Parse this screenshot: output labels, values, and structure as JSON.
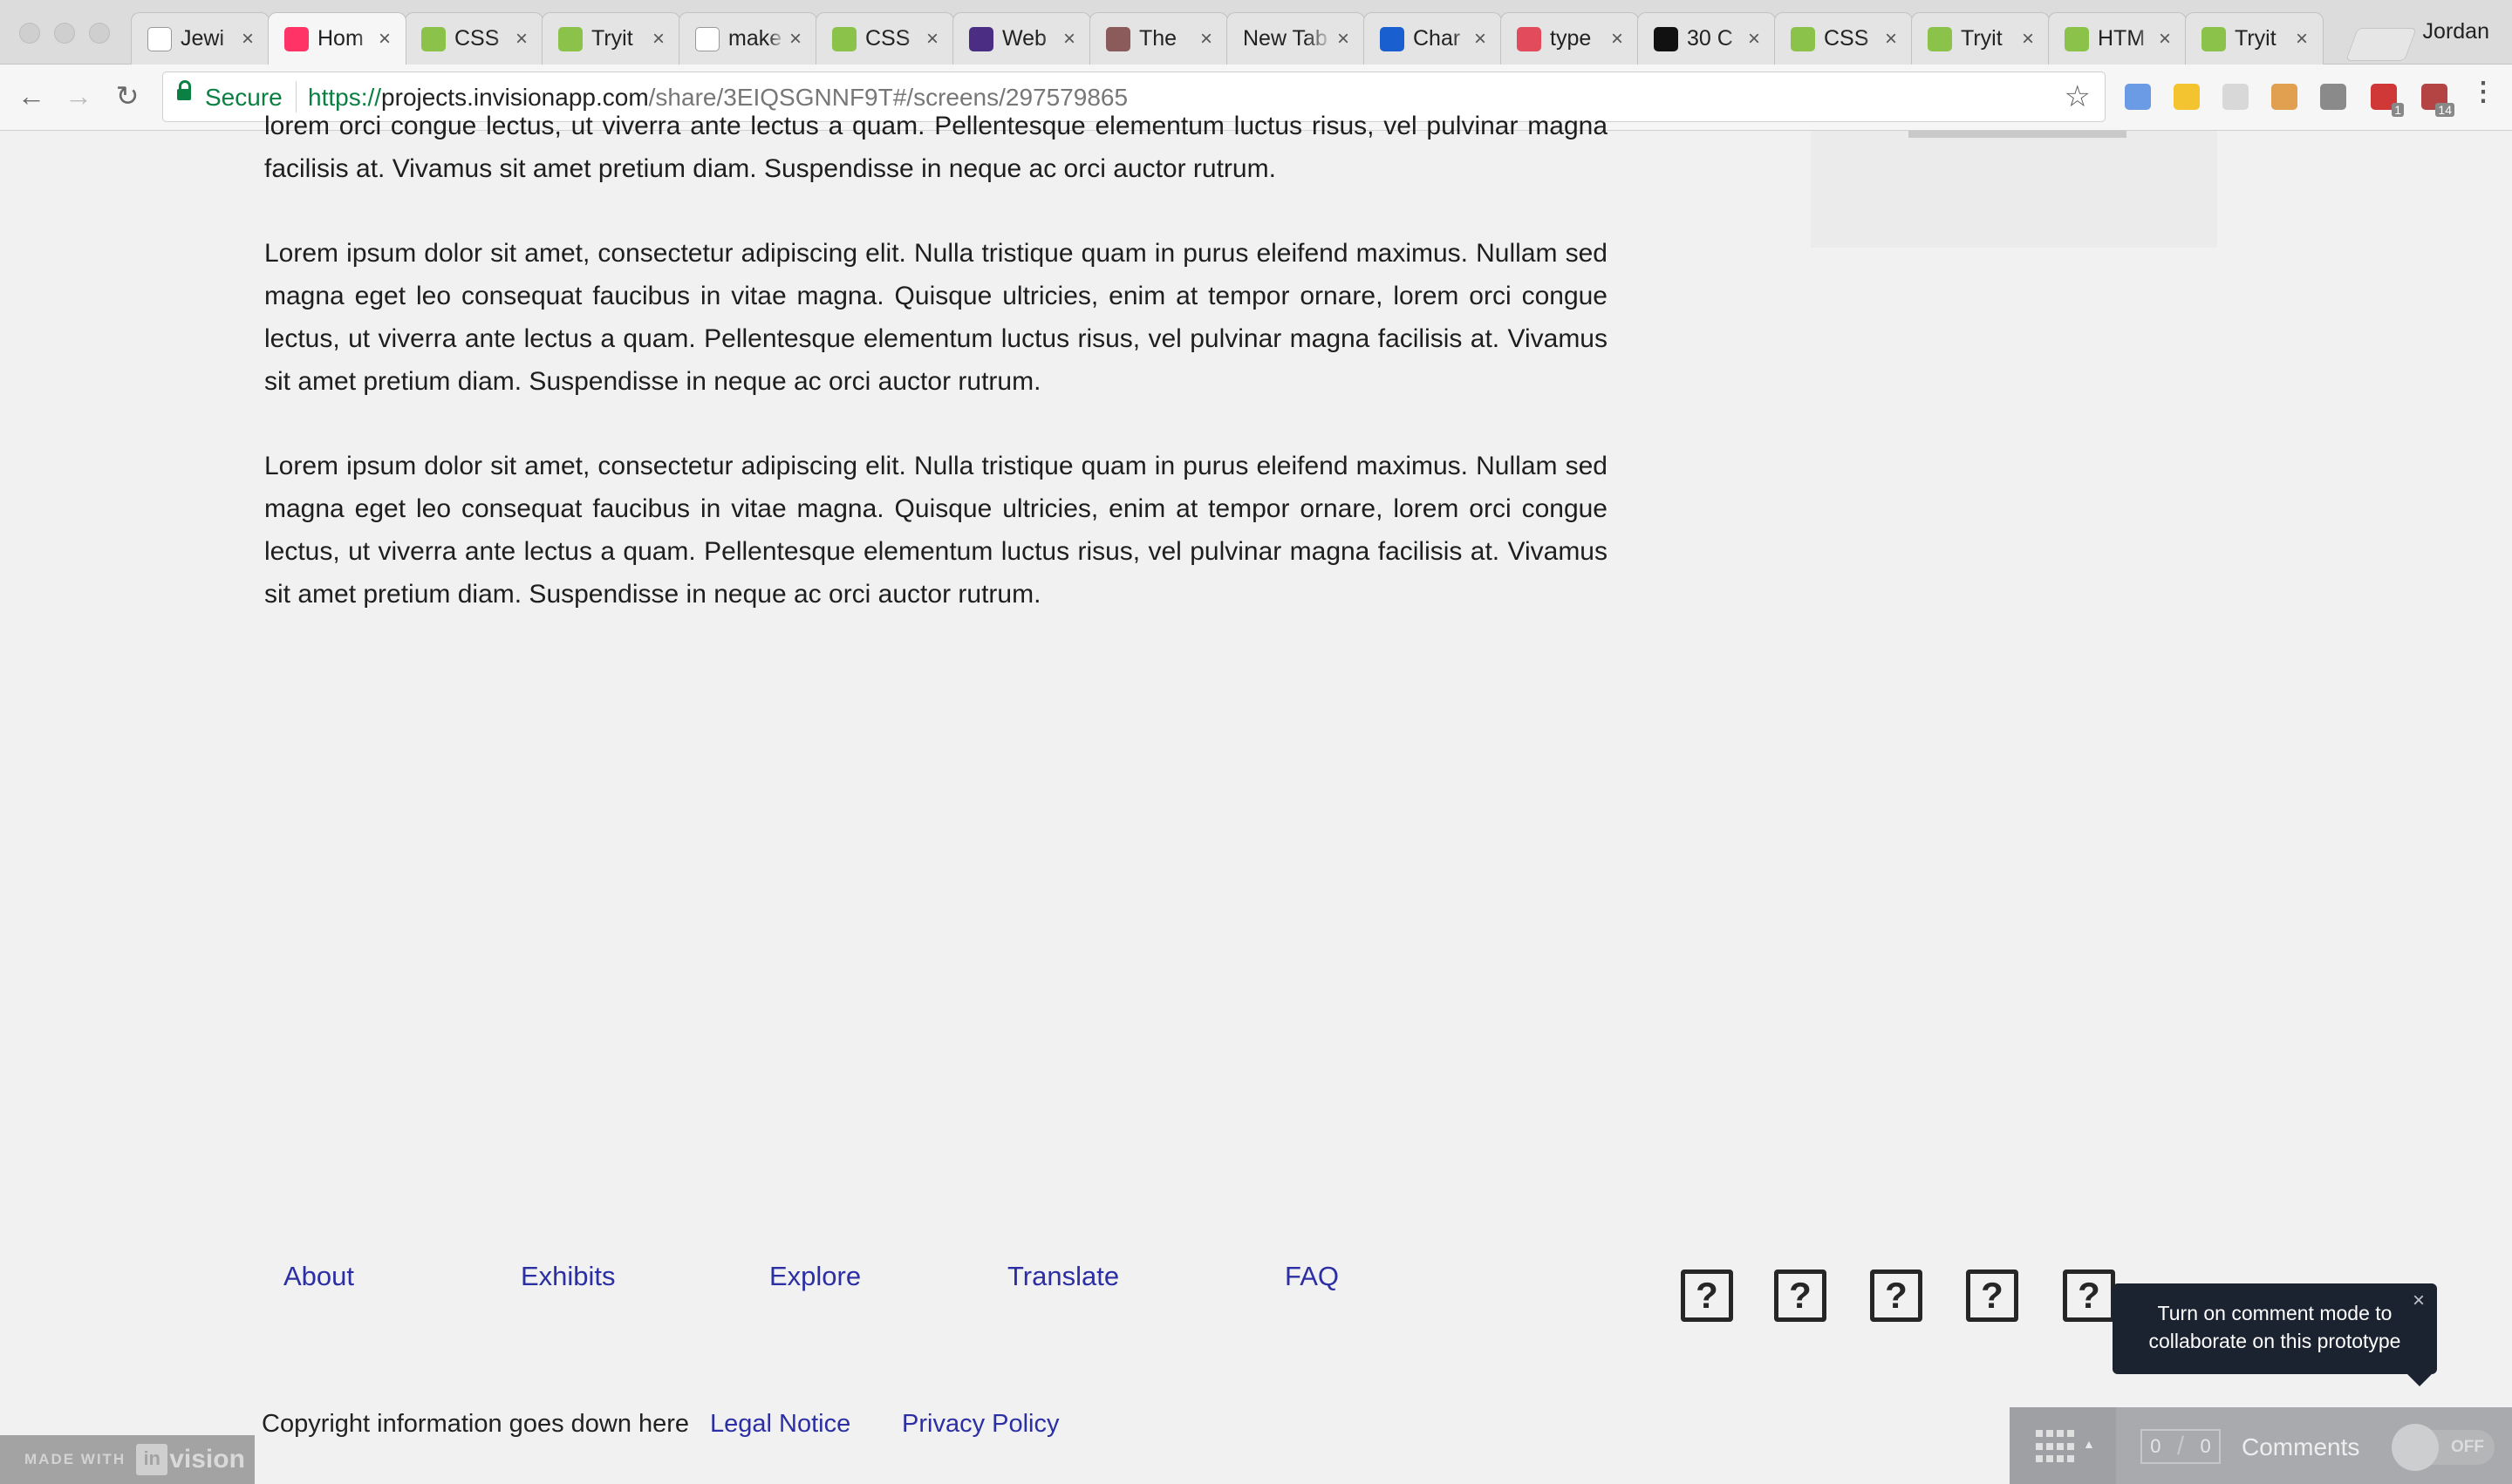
{
  "browser": {
    "tabs": [
      {
        "title": "Jewi",
        "icon": "document-icon",
        "color": "#ffffff"
      },
      {
        "title": "Hom",
        "icon": "invision-icon",
        "color": "#ff3366",
        "active": true
      },
      {
        "title": "CSS",
        "icon": "w3schools-icon",
        "color": "#8bc34a"
      },
      {
        "title": "Tryit",
        "icon": "w3schools-icon",
        "color": "#8bc34a"
      },
      {
        "title": "make",
        "icon": "google-icon",
        "color": "#ffffff"
      },
      {
        "title": "CSS",
        "icon": "w3schools-icon",
        "color": "#8bc34a"
      },
      {
        "title": "Web",
        "icon": "webflow-w-icon",
        "color": "#4b2e83"
      },
      {
        "title": "The",
        "icon": "brand-circle-icon",
        "color": "#8b5a5a"
      },
      {
        "title": "New Tab",
        "icon": "",
        "color": ""
      },
      {
        "title": "Char",
        "icon": "chart-icon",
        "color": "#1a5fd0"
      },
      {
        "title": "type",
        "icon": "type-icon",
        "color": "#e24b5b"
      },
      {
        "title": "30 C",
        "icon": "w-black-icon",
        "color": "#111111"
      },
      {
        "title": "CSS",
        "icon": "w3schools-icon",
        "color": "#8bc34a"
      },
      {
        "title": "Tryit",
        "icon": "w3schools-icon",
        "color": "#8bc34a"
      },
      {
        "title": "HTM",
        "icon": "w3schools-icon",
        "color": "#8bc34a"
      },
      {
        "title": "Tryit",
        "icon": "w3schools-icon",
        "color": "#8bc34a"
      }
    ],
    "profile_name": "Jordan",
    "address": {
      "secure_label": "Secure",
      "scheme": "https://",
      "host": "projects.invisionapp.com",
      "path": "/share/3EIQSGNNF9T#/screens/297579865"
    },
    "extensions": [
      {
        "icon": "extension-blue-icon",
        "color": "#6c9be6"
      },
      {
        "icon": "extension-pencil-icon",
        "color": "#f4c430"
      },
      {
        "icon": "extension-document-icon",
        "color": "#d8d8d8"
      },
      {
        "icon": "extension-ruler-icon",
        "color": "#e0a050"
      },
      {
        "icon": "extension-s-icon",
        "color": "#8a8a8a"
      },
      {
        "icon": "extension-adblock-icon",
        "color": "#d03838",
        "badge": "1"
      },
      {
        "icon": "extension-calendar-icon",
        "color": "#b44444",
        "badge": "14"
      }
    ]
  },
  "content": {
    "partial_paragraph": "lorem orci congue lectus, ut viverra ante lectus a quam. Pellentesque elementum luctus risus, vel pulvinar magna facilisis at. Vivamus sit amet pretium diam. Suspendisse in neque ac orci auctor rutrum.",
    "paragraph": "Lorem ipsum dolor sit amet, consectetur adipiscing elit. Nulla tristique quam in purus eleifend maximus. Nullam sed magna eget leo consequat faucibus in vitae magna. Quisque ultricies, enim at tempor ornare, lorem orci congue lectus, ut viverra ante lectus a quam. Pellentesque elementum luctus risus, vel pulvinar magna facilisis at. Vivamus sit amet pretium diam. Suspendisse in neque ac orci auctor rutrum."
  },
  "footer": {
    "links": [
      "About",
      "Exhibits",
      "Explore",
      "Translate",
      "FAQ"
    ],
    "social_glyph": "?",
    "copyright": "Copyright information goes down here",
    "legal_notice": "Legal Notice",
    "privacy_policy": "Privacy Policy"
  },
  "invision": {
    "made_with": "MADE WITH",
    "logo_glyph": "in",
    "brand": "vision",
    "tooltip": "Turn on comment mode to collaborate on this prototype",
    "close_glyph": "×",
    "comment_count": "0",
    "comment_total": "0",
    "comments_label": "Comments",
    "toggle_label": "OFF"
  }
}
